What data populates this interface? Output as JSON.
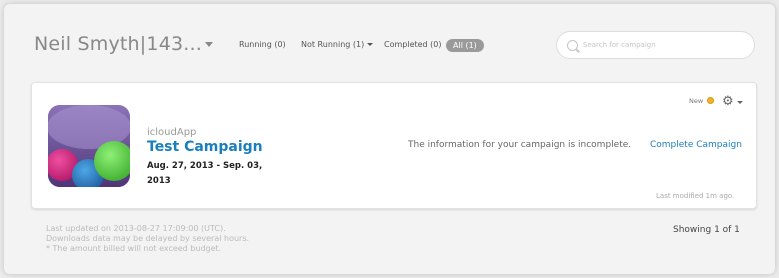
{
  "header": {
    "account_name": "Neil Smyth|143...",
    "filters": {
      "running": "Running (0)",
      "not_running": "Not Running (1)",
      "completed": "Completed (0)",
      "all": "All (1)"
    },
    "search_placeholder": "Search for campaign"
  },
  "campaign": {
    "app_name": "icloudApp",
    "title": "Test Campaign",
    "dates": "Aug. 27, 2013 - Sep. 03, 2013",
    "message": "The information for your campaign is incomplete.",
    "action_label": "Complete Campaign",
    "status_label": "New",
    "status_color": "#f3b326",
    "last_modified": "Last modified 1m ago.",
    "icon": "app-icon"
  },
  "footer": {
    "last_updated": "Last updated on 2013-08-27 17:09:00 (UTC).",
    "delay_note": "Downloads data may be delayed by several hours.",
    "budget_note": "* The amount billed will not exceed budget.",
    "showing": "Showing 1 of 1"
  },
  "colors": {
    "link": "#1a7fbc",
    "background": "#ebebeb",
    "card": "#ffffff"
  }
}
